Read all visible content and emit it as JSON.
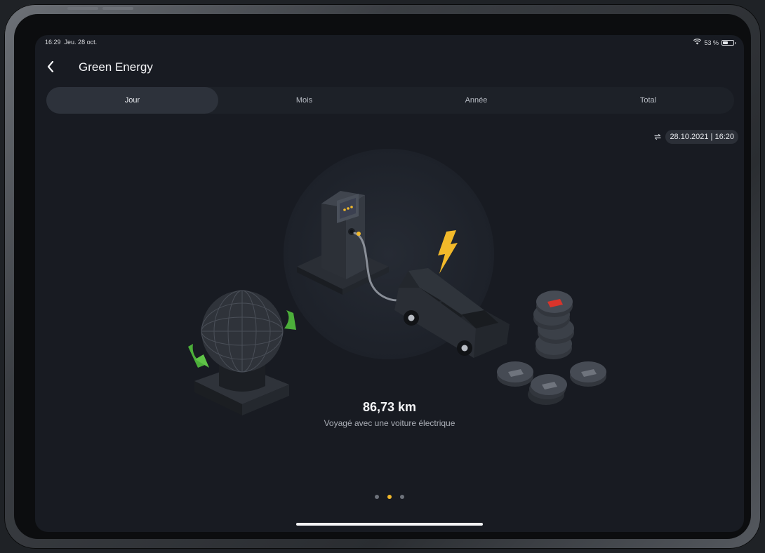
{
  "status_bar": {
    "time": "16:29",
    "date": "Jeu. 28 oct.",
    "battery": "53 %",
    "battery_level": 0.53
  },
  "header": {
    "title": "Green Energy"
  },
  "tabs": [
    {
      "label": "Jour",
      "active": true
    },
    {
      "label": "Mois",
      "active": false
    },
    {
      "label": "Année",
      "active": false
    },
    {
      "label": "Total",
      "active": false
    }
  ],
  "updated": {
    "timestamp": "28.10.2021 | 16:20"
  },
  "metric": {
    "value": "86,73 km",
    "caption": "Voyagé avec une voiture électrique"
  },
  "pager": {
    "count": 3,
    "active_index": 1
  },
  "colors": {
    "background": "#181b22",
    "accent": "#f2b92a",
    "green": "#4caf3a",
    "coin_red": "#d9342b"
  },
  "icons": [
    "back-chevron-icon",
    "wifi-icon",
    "battery-icon",
    "refresh-icon"
  ]
}
